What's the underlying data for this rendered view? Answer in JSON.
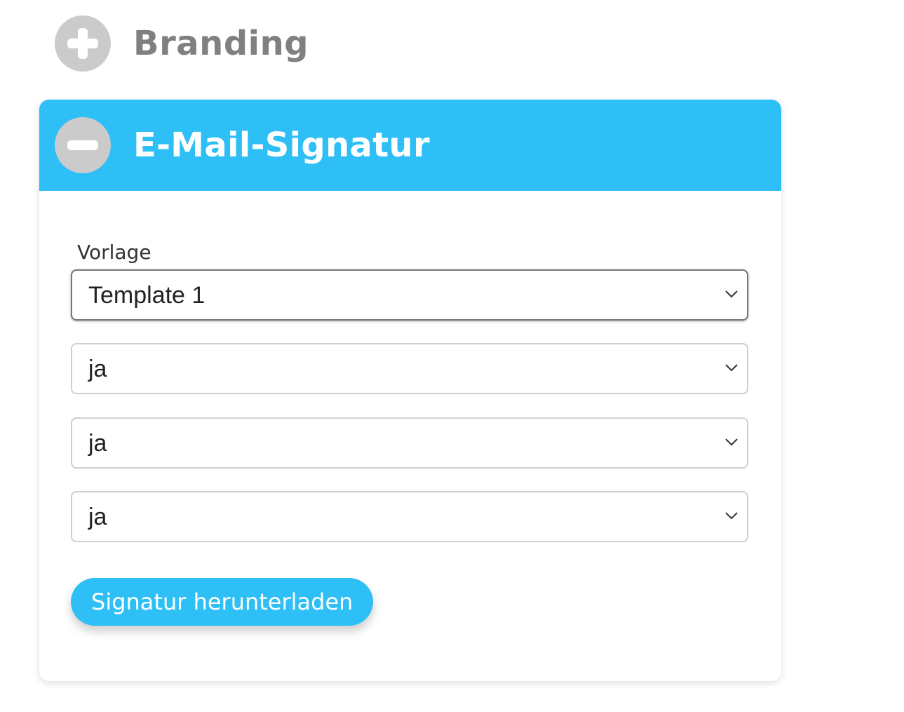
{
  "branding_section": {
    "title": "Branding",
    "expanded": false,
    "icon": "plus-circle-icon"
  },
  "signature_section": {
    "title": "E-Mail-Signatur",
    "expanded": true,
    "icon": "minus-circle-icon",
    "header_color": "#2dbff5",
    "template_field": {
      "label": "Vorlage",
      "value": "Template 1"
    },
    "option_selects": [
      {
        "value": "ja"
      },
      {
        "value": "ja"
      },
      {
        "value": "ja"
      }
    ],
    "download_button_label": "Signatur herunterladen"
  }
}
